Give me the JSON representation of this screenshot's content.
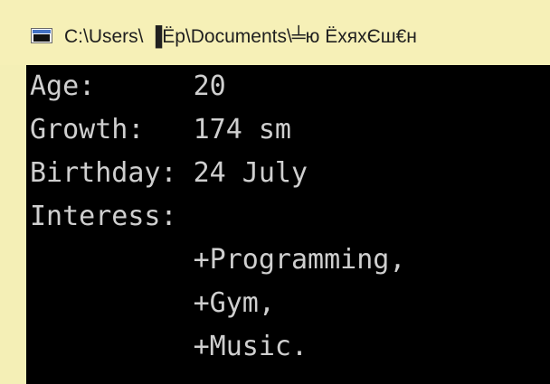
{
  "window": {
    "title": "C:\\Users\\ ▐Ёр\\Documents\\╧ю ЁхяхЄш€н"
  },
  "console": {
    "lines": [
      "Age:      20",
      "Growth:   174 sm",
      "Birthday: 24 July",
      "Interess:",
      "          +Programming,",
      "          +Gym,",
      "          +Music."
    ]
  },
  "icons": {
    "window_icon": "console-window-icon"
  },
  "colors": {
    "titlebar_background": "#f6f0b7",
    "title_text": "#202020",
    "console_background": "#000000",
    "console_text": "#cfcfcf"
  }
}
